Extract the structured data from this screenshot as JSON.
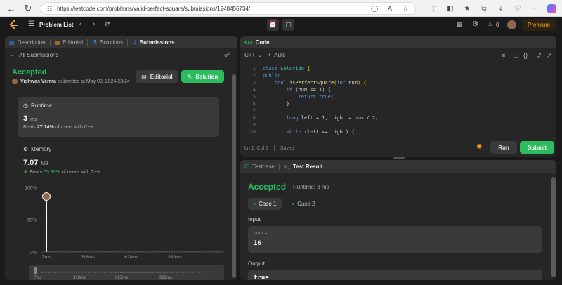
{
  "browser": {
    "url": "https://leetcode.com/problems/valid-perfect-square/submissions/1248456734/"
  },
  "topbar": {
    "problem_list": "Problem List",
    "counter": "0",
    "premium": "Premium"
  },
  "left": {
    "tabs": [
      "Description",
      "Editorial",
      "Solutions",
      "Submissions"
    ],
    "back_label": "All Submissions",
    "status": "Accepted",
    "author": "Vishwas Verma",
    "submitted_text": "submitted at May 03, 2024 23:24",
    "editorial_btn": "Editorial",
    "solution_btn": "Solution",
    "runtime": {
      "title": "Runtime",
      "value": "3",
      "unit": "ms",
      "beats_prefix": "Beats",
      "beats_value": "27.14%",
      "beats_suffix": "of users with C++"
    },
    "memory": {
      "title": "Memory",
      "value": "7.07",
      "unit": "MB",
      "beats_prefix": "Beats",
      "beats_value": "55.90%",
      "beats_suffix": "of users with C++"
    }
  },
  "chart_data": {
    "type": "bar",
    "title": "",
    "xlabel": "",
    "ylabel": "",
    "y_ticks": [
      "100%",
      "50%",
      "0%"
    ],
    "x_ticks": [
      "7ms",
      "318ms",
      "628ms",
      "939ms"
    ],
    "mini_ticks": [
      "7ms",
      "318ms",
      "623ms",
      "939ms"
    ],
    "ylim": [
      0,
      100
    ],
    "highlight_value": 100
  },
  "code_panel": {
    "tab": "Code",
    "language": "C++",
    "mode": "Auto",
    "status_position": "Ln 1, Col 1",
    "status_saved": "Saved",
    "run": "Run",
    "submit": "Submit",
    "line_numbers": [
      "1",
      "2",
      "3",
      "4",
      "5",
      "6",
      "7",
      "8",
      "9",
      "10"
    ]
  },
  "result_panel": {
    "tab1": "Testcase",
    "tab2": "Test Result",
    "status": "Accepted",
    "runtime": "Runtime: 3 ms",
    "case1": "Case 1",
    "case2": "Case 2",
    "input_label": "Input",
    "input_var": "num =",
    "input_value": "16",
    "output_label": "Output",
    "output_value": "true"
  },
  "colors": {
    "accent_green": "#2cbb5d",
    "premium_orange": "#ffa116",
    "bg_dark": "#1a1a1a",
    "panel": "#262626"
  }
}
